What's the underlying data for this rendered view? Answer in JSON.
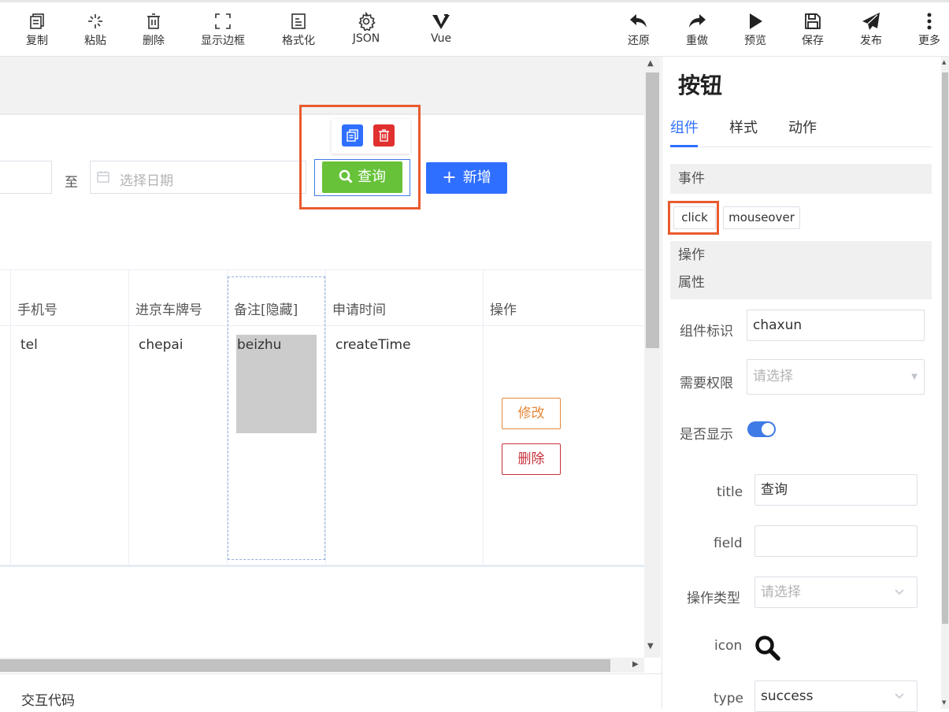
{
  "toolbar": {
    "left": [
      {
        "label": "复制",
        "icon": "copy-icon"
      },
      {
        "label": "粘贴",
        "icon": "paste-icon"
      },
      {
        "label": "删除",
        "icon": "trash-icon"
      },
      {
        "label": "显示边框",
        "icon": "frame-icon"
      },
      {
        "label": "格式化",
        "icon": "format-icon"
      },
      {
        "label": "JSON",
        "icon": "gear-icon"
      },
      {
        "label": "Vue",
        "icon": "vue-icon"
      }
    ],
    "right": [
      {
        "label": "还原",
        "icon": "undo-icon"
      },
      {
        "label": "重做",
        "icon": "redo-icon"
      },
      {
        "label": "预览",
        "icon": "play-icon"
      },
      {
        "label": "保存",
        "icon": "save-icon"
      },
      {
        "label": "发布",
        "icon": "send-icon"
      },
      {
        "label": "更多",
        "icon": "more-icon"
      }
    ]
  },
  "search": {
    "to_label": "至",
    "date_placeholder": "选择日期",
    "query_label": "查询",
    "add_label": "新增"
  },
  "table": {
    "headers": [
      "手机号",
      "进京车牌号",
      "备注[隐藏]",
      "申请时间",
      "操作"
    ],
    "row": [
      "tel",
      "chepai",
      "beizhu",
      "createTime"
    ],
    "actions": {
      "edit": "修改",
      "delete": "删除"
    }
  },
  "bottom": {
    "code_label": "交互代码"
  },
  "panel": {
    "title": "按钮",
    "tabs": [
      "组件",
      "样式",
      "动作"
    ],
    "active_tab": "组件",
    "sections": {
      "events": "事件",
      "operations": "操作",
      "properties": "属性"
    },
    "events": [
      "click",
      "mouseover"
    ],
    "fields": {
      "id_label": "组件标识",
      "id_value": "chaxun",
      "perm_label": "需要权限",
      "perm_placeholder": "请选择",
      "show_label": "是否显示",
      "show_value": true,
      "title_label": "title",
      "title_value": "查询",
      "field_label": "field",
      "field_value": "",
      "optype_label": "操作类型",
      "optype_placeholder": "请选择",
      "icon_label": "icon",
      "icon_value": "search-icon",
      "type_label": "type",
      "type_value": "success"
    }
  },
  "colors": {
    "accent": "#2f6fff",
    "success": "#67c23a",
    "highlight": "#ea5a2e",
    "danger": "#e0302f",
    "warning": "#e6883a"
  }
}
